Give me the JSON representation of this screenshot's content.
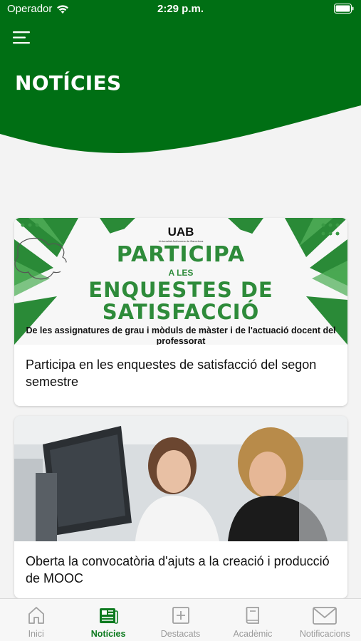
{
  "status_bar": {
    "carrier": "Operador",
    "time": "2:29 p.m."
  },
  "header": {
    "title": "NOTÍCIES",
    "menu_icon": "hamburger-menu-icon",
    "color": "#006f14"
  },
  "news": [
    {
      "title": "Participa en les enquestes de satisfacció del segon semestre",
      "poster": {
        "logo": "UAB",
        "logo_sub": "Universitat Autònoma de Barcelona",
        "line1": "PARTICIPA",
        "line2": "A LES",
        "line3": "ENQUESTES DE SATISFACCIÓ",
        "line4": "De les assignatures de grau i mòduls de màster i de l'actuació docent del professorat"
      }
    },
    {
      "title": "Oberta la convocatòria d'ajuts a la creació i producció de MOOC",
      "image": "photo-two-women-at-computer"
    }
  ],
  "tabbar": {
    "active_color": "#0d7a1f",
    "tabs": [
      {
        "label": "Inici",
        "icon": "home-icon"
      },
      {
        "label": "Notícies",
        "icon": "newspaper-icon"
      },
      {
        "label": "Destacats",
        "icon": "plus-square-icon"
      },
      {
        "label": "Acadèmic",
        "icon": "book-icon"
      },
      {
        "label": "Notificacions",
        "icon": "envelope-icon"
      }
    ]
  }
}
